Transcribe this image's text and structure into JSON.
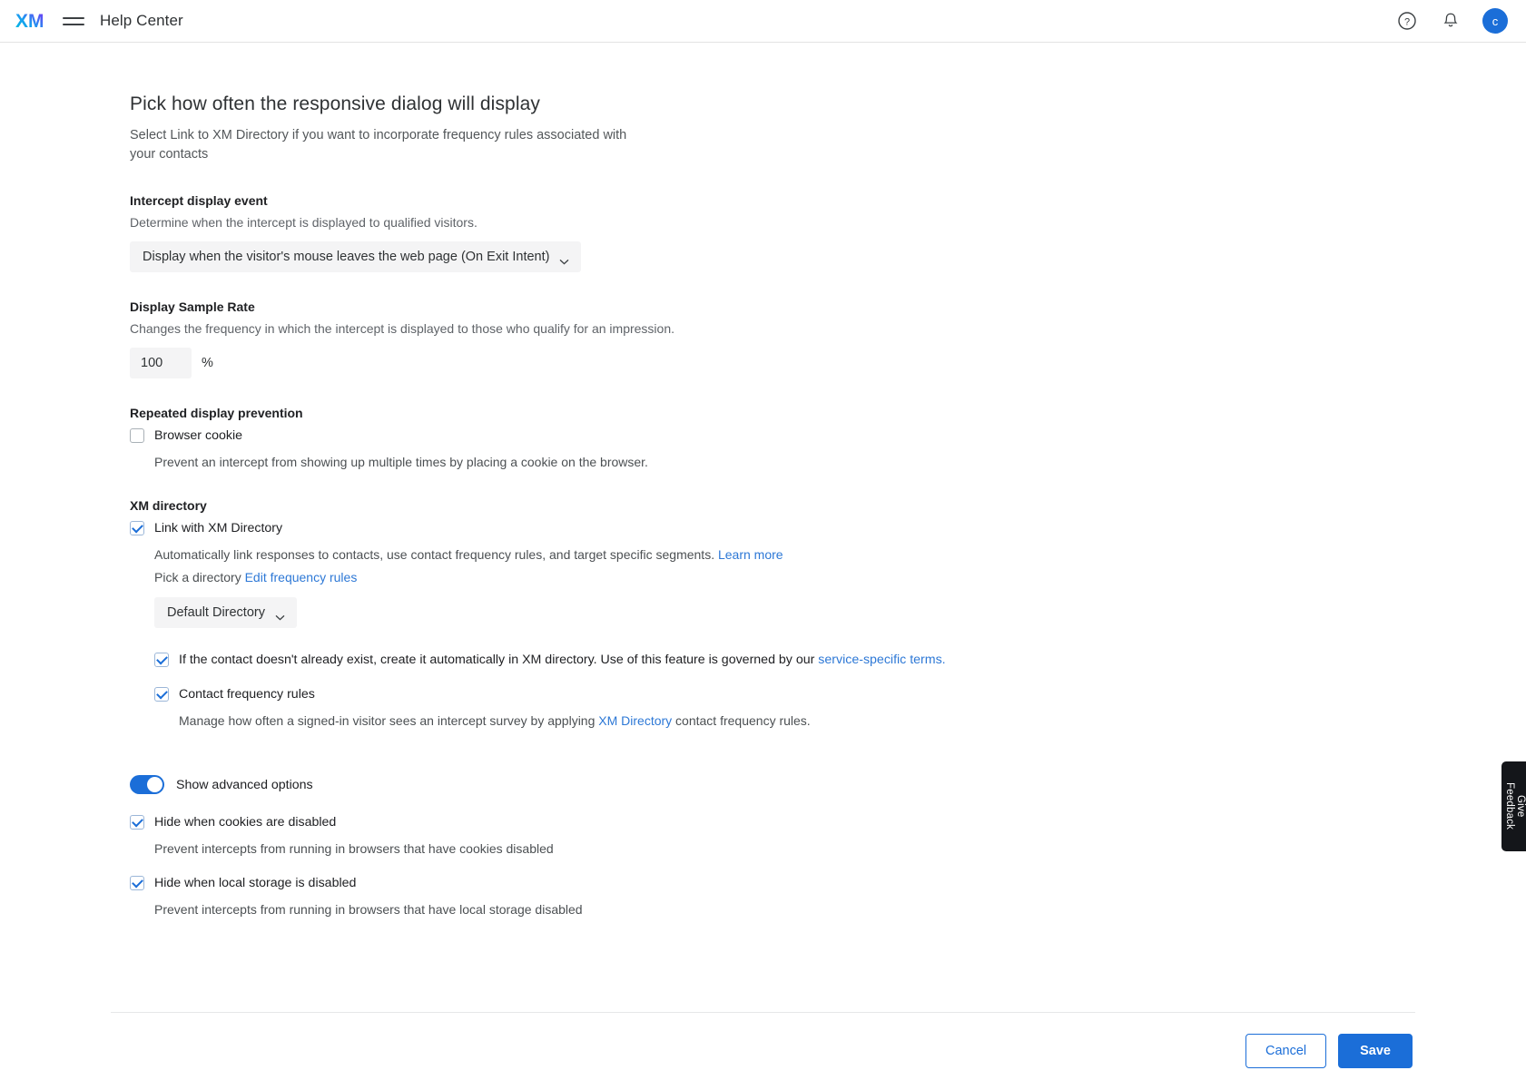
{
  "header": {
    "logo_alt": "XM",
    "menu_icon": "hamburger-icon",
    "app_title": "Help Center",
    "help_icon": "question-circle-icon",
    "notifications_icon": "bell-icon",
    "avatar_initial": "c"
  },
  "main": {
    "title": "Pick how often the responsive dialog will display",
    "subtitle": "Select Link to XM Directory if you want to incorporate frequency rules associated with your contacts",
    "intercept_display_event": {
      "label": "Intercept display event",
      "description": "Determine when the intercept is displayed to qualified visitors.",
      "selected": "Display when the visitor's mouse leaves the web page (On Exit Intent)"
    },
    "display_sample_rate": {
      "label": "Display Sample Rate",
      "description": "Changes the frequency in which the intercept is displayed to those who qualify for an impression.",
      "value": "100",
      "unit": "%"
    },
    "repeated_display_prevention": {
      "label": "Repeated display prevention",
      "browser_cookie": {
        "label": "Browser cookie",
        "checked": false,
        "description": "Prevent an intercept from showing up multiple times by placing a cookie on the browser."
      }
    },
    "xm_directory": {
      "label": "XM directory",
      "link_with_directory": {
        "label": "Link with XM Directory",
        "checked": true,
        "description": "Automatically link responses to contacts, use contact frequency rules, and target specific segments.",
        "learn_more": "Learn more"
      },
      "pick_a_directory_label": "Pick a directory",
      "edit_frequency_rules": "Edit frequency rules",
      "directory_selected": "Default Directory",
      "auto_create_contact": {
        "label_before": "If the contact doesn't already exist, create it automatically in XM directory. Use of this feature is governed by our ",
        "link": "service-specific terms.",
        "checked": true
      },
      "contact_frequency_rules": {
        "label": "Contact frequency rules",
        "checked": true,
        "description_before": "Manage how often a signed-in visitor sees an intercept survey by applying ",
        "link": "XM Directory",
        "description_after": " contact frequency rules."
      }
    },
    "advanced": {
      "toggle_label": "Show advanced options",
      "toggle_on": true,
      "hide_cookies": {
        "label": "Hide when cookies are disabled",
        "checked": true,
        "description": "Prevent intercepts from running in browsers that have cookies disabled"
      },
      "hide_local_storage": {
        "label": "Hide when local storage is disabled",
        "checked": true,
        "description": "Prevent intercepts from running in browsers that have local storage disabled"
      }
    }
  },
  "footer": {
    "cancel_label": "Cancel",
    "save_label": "Save"
  },
  "feedback_tab": {
    "label": "Give Feedback"
  },
  "colors": {
    "accent": "#1b6ed8",
    "link": "#2d78d6",
    "control_bg": "#f4f4f5",
    "feedback_bg": "#14161a"
  }
}
